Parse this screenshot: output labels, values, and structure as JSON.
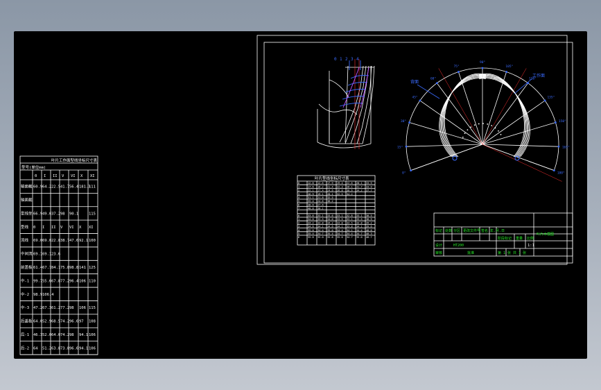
{
  "colors": {
    "background": "#000000",
    "lines": "#ffffff",
    "dimension": "#3a6bff",
    "titleblock_text": "#27e827",
    "centerline": "#ff3030"
  },
  "left_table": {
    "title": "叶片工作面型线坐标尺寸表",
    "subtitle": "型号(单位mm)",
    "header": [
      "",
      "0",
      "I",
      "II",
      "V",
      "VI",
      "X",
      "XI"
    ],
    "rows": [
      {
        "label": "轴面截线(前盖板)",
        "values": [
          "60.9",
          "64.2",
          "22.5",
          "41.7",
          "56.4",
          "181.3",
          "111"
        ]
      },
      {
        "label": "轴面截线(后盖板)",
        "values": [
          "",
          "",
          "",
          "",
          "",
          "",
          ""
        ]
      },
      {
        "label": "型线坐标",
        "values": [
          "66.9",
          "49.0",
          "37.2",
          "98",
          "90.1",
          "",
          "115"
        ]
      },
      {
        "label": "型线",
        "values": [
          "0",
          "I",
          "II",
          "V",
          "VI",
          "X",
          "XI"
        ]
      },
      {
        "label": "流线",
        "values": [
          "69.0",
          "69.0",
          "22.8",
          "38.7",
          "47.6",
          "92.1",
          "100"
        ]
      },
      {
        "label": "中间流线",
        "values": [
          "69.1",
          "69.1",
          "23.6",
          "",
          "",
          "",
          ""
        ]
      },
      {
        "label": "前盖板",
        "values": [
          "61.4",
          "67.7",
          "84.1",
          "75.8",
          "98.8",
          "141",
          "125"
        ]
      },
      {
        "label": "中-1",
        "values": [
          "99.7",
          "55.6",
          "67.8",
          "77.2",
          "96.4",
          "106",
          "110"
        ]
      },
      {
        "label": "中-2",
        "values": [
          "98.9",
          "106.4",
          "",
          "",
          "",
          "",
          ""
        ]
      },
      {
        "label": "中-3",
        "values": [
          "47.2",
          "67.3",
          "61.2",
          "77.2",
          "98",
          "106",
          "115"
        ]
      },
      {
        "label": "后盖板",
        "values": [
          "64.0",
          "52.9",
          "68.5",
          "74.2",
          "96.6",
          "97",
          "108"
        ]
      },
      {
        "label": "后-1",
        "values": [
          "46.3",
          "52.0",
          "64.0",
          "74.2",
          "98",
          "94.1",
          "106"
        ]
      },
      {
        "label": "后-2",
        "values": [
          "64",
          "51.2",
          "63.8",
          "73.8",
          "96.6",
          "94.1",
          "106"
        ]
      }
    ]
  },
  "middle_table": {
    "title": "叶片型线坐标尺寸表",
    "rows": [
      [
        "0",
        "12.8",
        "12.6",
        "17.9",
        "19.4",
        "22.6",
        "28.1",
        "33.9"
      ],
      [
        "1",
        "17.6",
        "16.2",
        "21.4",
        "22.3",
        "26.1",
        "31.7",
        "33.9"
      ],
      [
        "2",
        "22.1",
        "17.4",
        "24.6",
        "26.8",
        "30.6",
        "34.2",
        "37.7"
      ],
      [
        "3",
        "26.9",
        "19.1",
        "28.1",
        "32.5",
        "34.2",
        "",
        ""
      ],
      [
        "4",
        "31.1",
        "21.8",
        "32.5",
        "",
        "",
        "",
        ""
      ],
      [
        "5",
        "35.4",
        "24.6",
        "38.2",
        "",
        "",
        "",
        ""
      ],
      [
        "6",
        "38.6",
        "27.6",
        "",
        "",
        "",
        "",
        ""
      ],
      [
        "7",
        "40.8",
        "30.1",
        "",
        "",
        "",
        "",
        ""
      ]
    ],
    "rows2": [
      [
        "0",
        "33.6",
        "33.1",
        "33.6",
        "33.1",
        "32.8",
        "33.1",
        "38.5"
      ],
      [
        "1",
        "34.0",
        "33.5",
        "34.0",
        "33.5",
        "33.1",
        "33.5",
        "38.9"
      ],
      [
        "2",
        "34.2",
        "33.8",
        "34.2",
        "33.8",
        "33.5",
        "33.8",
        "39.2"
      ],
      [
        "3",
        "34.6",
        "34.1",
        "34.6",
        "34.1",
        "33.8",
        "34.1",
        "39.6"
      ],
      [
        "4",
        "35.0",
        "34.4",
        "35.0",
        "34.4",
        "34.1",
        "34.4",
        "40.0"
      ],
      [
        "5",
        "35.4",
        "34.7",
        "35.4",
        "34.7",
        "34.4",
        "34.7",
        "40.3"
      ],
      [
        "6",
        "35.8",
        "35.0",
        "35.8",
        "35.0",
        "34.7",
        "35.0",
        "40.7"
      ]
    ]
  },
  "views": {
    "angle_labels": [
      "0°",
      "15°",
      "30°",
      "45°",
      "60°",
      "75°",
      "90°",
      "105°",
      "120°",
      "135°",
      "150°",
      "165°",
      "180°"
    ],
    "leader_labels": [
      "背面",
      "工作面"
    ],
    "meridian_labels": [
      "0",
      "1",
      "2",
      "3",
      "4"
    ]
  },
  "title_block": {
    "name": "叶片木模图",
    "scale": "1:1",
    "material": "HT200",
    "sheet": "第 1 张  共 1 张",
    "cells": [
      "标记",
      "处数",
      "分区",
      "更改文件号",
      "签名",
      "年.月.日",
      "设计",
      "标准化",
      "阶段标记",
      "重量",
      "比例",
      "审核",
      "工艺",
      "批准"
    ]
  }
}
